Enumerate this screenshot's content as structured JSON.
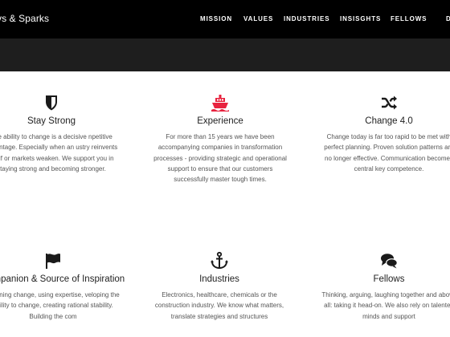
{
  "header": {
    "brand": "vs & Sparks",
    "nav": [
      {
        "label": "MISSION"
      },
      {
        "label": "VALUES"
      },
      {
        "label": "INDUSTRIES"
      },
      {
        "label": "INSISGHTS"
      },
      {
        "label": "FELLOWS"
      },
      {
        "label": "D"
      }
    ]
  },
  "cards": [
    {
      "title": "Stay Strong",
      "icon": "shield-icon",
      "text": "The ability to change is a decisive npetitive advantage. Especially when an ustry reinvents itself or markets weaken. We support you in staying strong and becoming stronger."
    },
    {
      "title": "Experience",
      "icon": "ship-icon",
      "text": "For more than 15 years we have been accompanying companies in transformation processes - providing strategic and operational support to ensure that our customers successfully master tough times."
    },
    {
      "title": "Change 4.0",
      "icon": "shuffle-icon",
      "text": "Change today is far too rapid to be met with perfect planning. Proven solution patterns are no longer effective. Communication becomes central key competence."
    },
    {
      "title": "Companion & Source of Inspiration",
      "icon": "flag-icon",
      "text": "Planning change, using expertise, veloping the ability to change, creating rational stability. Building the com"
    },
    {
      "title": "Industries",
      "icon": "anchor-icon",
      "text": "Electronics, healthcare, chemicals or the construction industry. We know what matters, translate strategies and structures"
    },
    {
      "title": "Fellows",
      "icon": "comments-icon",
      "text": "Thinking, arguing, laughing together and above all: taking it head-on. We also rely on talented minds and support"
    }
  ],
  "colors": {
    "topbar": "#000000",
    "band": "#1e1e1e",
    "accent": "#e8233f",
    "icon": "#1a1a1a"
  }
}
